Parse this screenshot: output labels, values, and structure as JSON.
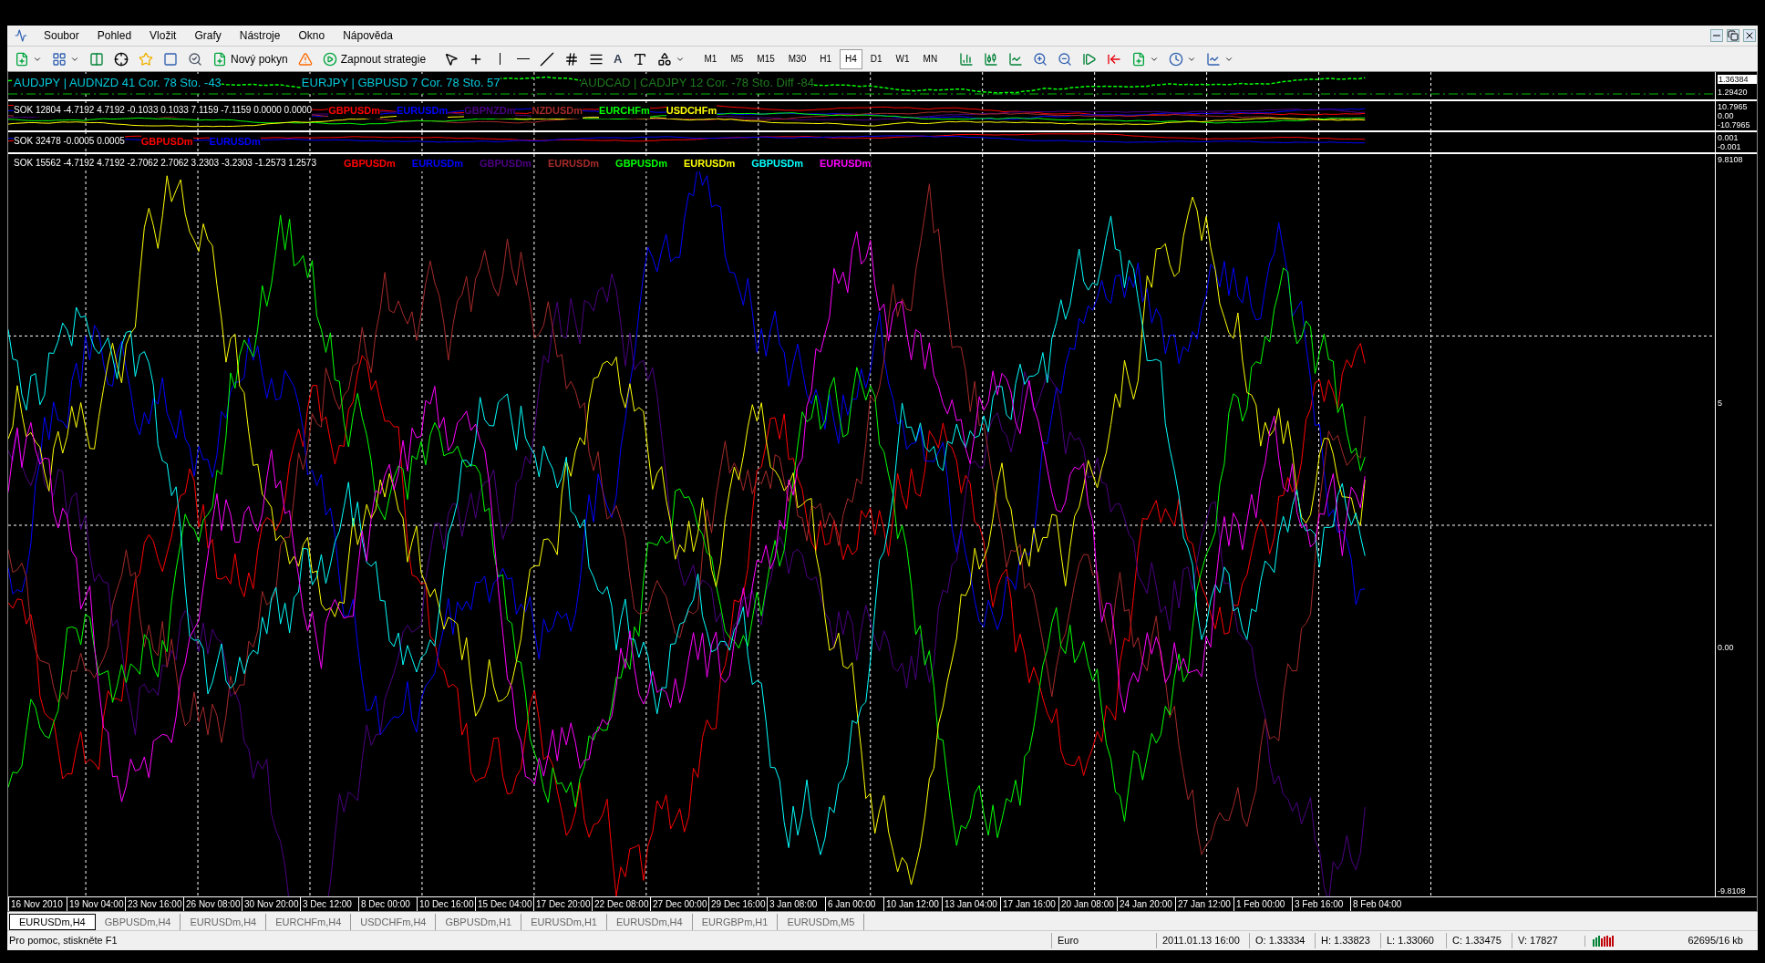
{
  "menu": [
    "Soubor",
    "Pohled",
    "Vložit",
    "Grafy",
    "Nástroje",
    "Okno",
    "Nápověda"
  ],
  "toolbar": {
    "new_order": "Nový pokyn",
    "strategies": "Zapnout strategie",
    "text_tool": "A",
    "timeframes": [
      {
        "label": "M1",
        "selected": false
      },
      {
        "label": "M5",
        "selected": false
      },
      {
        "label": "M15",
        "selected": false
      },
      {
        "label": "M30",
        "selected": false
      },
      {
        "label": "H1",
        "selected": false
      },
      {
        "label": "H4",
        "selected": true
      },
      {
        "label": "D1",
        "selected": false
      },
      {
        "label": "W1",
        "selected": false
      },
      {
        "label": "MN",
        "selected": false
      }
    ]
  },
  "panes": [
    {
      "kind": "pairs",
      "labels": [
        {
          "text": "AUDJPY | AUDNZD  41   Cor. 78   Sto. -43",
          "color": "#00c8d8"
        },
        {
          "text": "EURJPY | GBPUSD  7   Cor. 78   Sto. 57",
          "color": "#00c8d8"
        },
        {
          "text": "AUDCAD | CADJPY  12   Cor. -78   Sto. Diff -84",
          "color": "#1f7a1f"
        }
      ],
      "axis": [
        "1.36384",
        "1.29420"
      ]
    },
    {
      "kind": "oscillator",
      "header": "SOK 12804 -4.7192 4.7192 -0.1033 0.1033 7.1159 -7.1159 0.0000 0.0000",
      "labels": [
        {
          "text": "GBPUSDm",
          "color": "#ff0000"
        },
        {
          "text": "EURUSDm",
          "color": "#0000ff"
        },
        {
          "text": "GBPNZDm",
          "color": "#4b0082"
        },
        {
          "text": "NZDUSDm",
          "color": "#a52a2a"
        },
        {
          "text": "EURCHFm",
          "color": "#00ff00"
        },
        {
          "text": "USDCHFm",
          "color": "#ffff00"
        }
      ],
      "axis": [
        "10.7965",
        "0.00",
        "-10.7965"
      ]
    },
    {
      "kind": "oscillator",
      "header": "SOK 32478 -0.0005 0.0005",
      "labels": [
        {
          "text": "GBPUSDm",
          "color": "#ff0000"
        },
        {
          "text": "EURUSDm",
          "color": "#0000ff"
        }
      ],
      "axis": [
        "0.001",
        "-0.001"
      ]
    },
    {
      "kind": "main",
      "header": "SOK 15562 -4.7192 4.7192 -2.7062 2.7062 3.2303 -3.2303 -1.2573 1.2573",
      "labels": [
        {
          "text": "GBPUSDm",
          "color": "#ff0000"
        },
        {
          "text": "EURUSDm",
          "color": "#0000ff"
        },
        {
          "text": "GBPUSDm",
          "color": "#4b0082"
        },
        {
          "text": "EURUSDm",
          "color": "#a52a2a"
        },
        {
          "text": "GBPUSDm",
          "color": "#00ff00"
        },
        {
          "text": "EURUSDm",
          "color": "#ffff00"
        },
        {
          "text": "GBPUSDm",
          "color": "#00ffff"
        },
        {
          "text": "EURUSDm",
          "color": "#ff00ff"
        }
      ],
      "axis": [
        "9.8108",
        "5",
        "0.00",
        "-9.8108"
      ]
    }
  ],
  "time_axis": [
    "16 Nov 2010",
    "19 Nov 04:00",
    "23 Nov 16:00",
    "26 Nov 08:00",
    "30 Nov 20:00",
    "3 Dec 12:00",
    "8 Dec 00:00",
    "10 Dec 16:00",
    "15 Dec 04:00",
    "17 Dec 20:00",
    "22 Dec 08:00",
    "27 Dec 00:00",
    "29 Dec 16:00",
    "3 Jan 08:00",
    "6 Jan 00:00",
    "10 Jan 12:00",
    "13 Jan 04:00",
    "17 Jan 16:00",
    "20 Jan 08:00",
    "24 Jan 20:00",
    "27 Jan 12:00",
    "1 Feb 00:00",
    "3 Feb 16:00",
    "8 Feb 04:00"
  ],
  "chart_tabs": [
    {
      "label": "EURUSDm,H4",
      "selected": true
    },
    {
      "label": "GBPUSDm,H4",
      "selected": false
    },
    {
      "label": "EURUSDm,H4",
      "selected": false
    },
    {
      "label": "EURCHFm,H4",
      "selected": false
    },
    {
      "label": "USDCHFm,H4",
      "selected": false
    },
    {
      "label": "GBPUSDm,H1",
      "selected": false
    },
    {
      "label": "EURUSDm,H1",
      "selected": false
    },
    {
      "label": "EURUSDm,H4",
      "selected": false
    },
    {
      "label": "EURGBPm,H1",
      "selected": false
    },
    {
      "label": "EURUSDm,M5",
      "selected": false
    }
  ],
  "status_bar": {
    "help": "Pro pomoc, stiskněte F1",
    "fields": [
      "Euro",
      "2011.01.13 16:00",
      "O: 1.33334",
      "H: 1.33823",
      "L: 1.33060",
      "C: 1.33475",
      "V: 17827"
    ],
    "memory": "62695/16 kb"
  }
}
